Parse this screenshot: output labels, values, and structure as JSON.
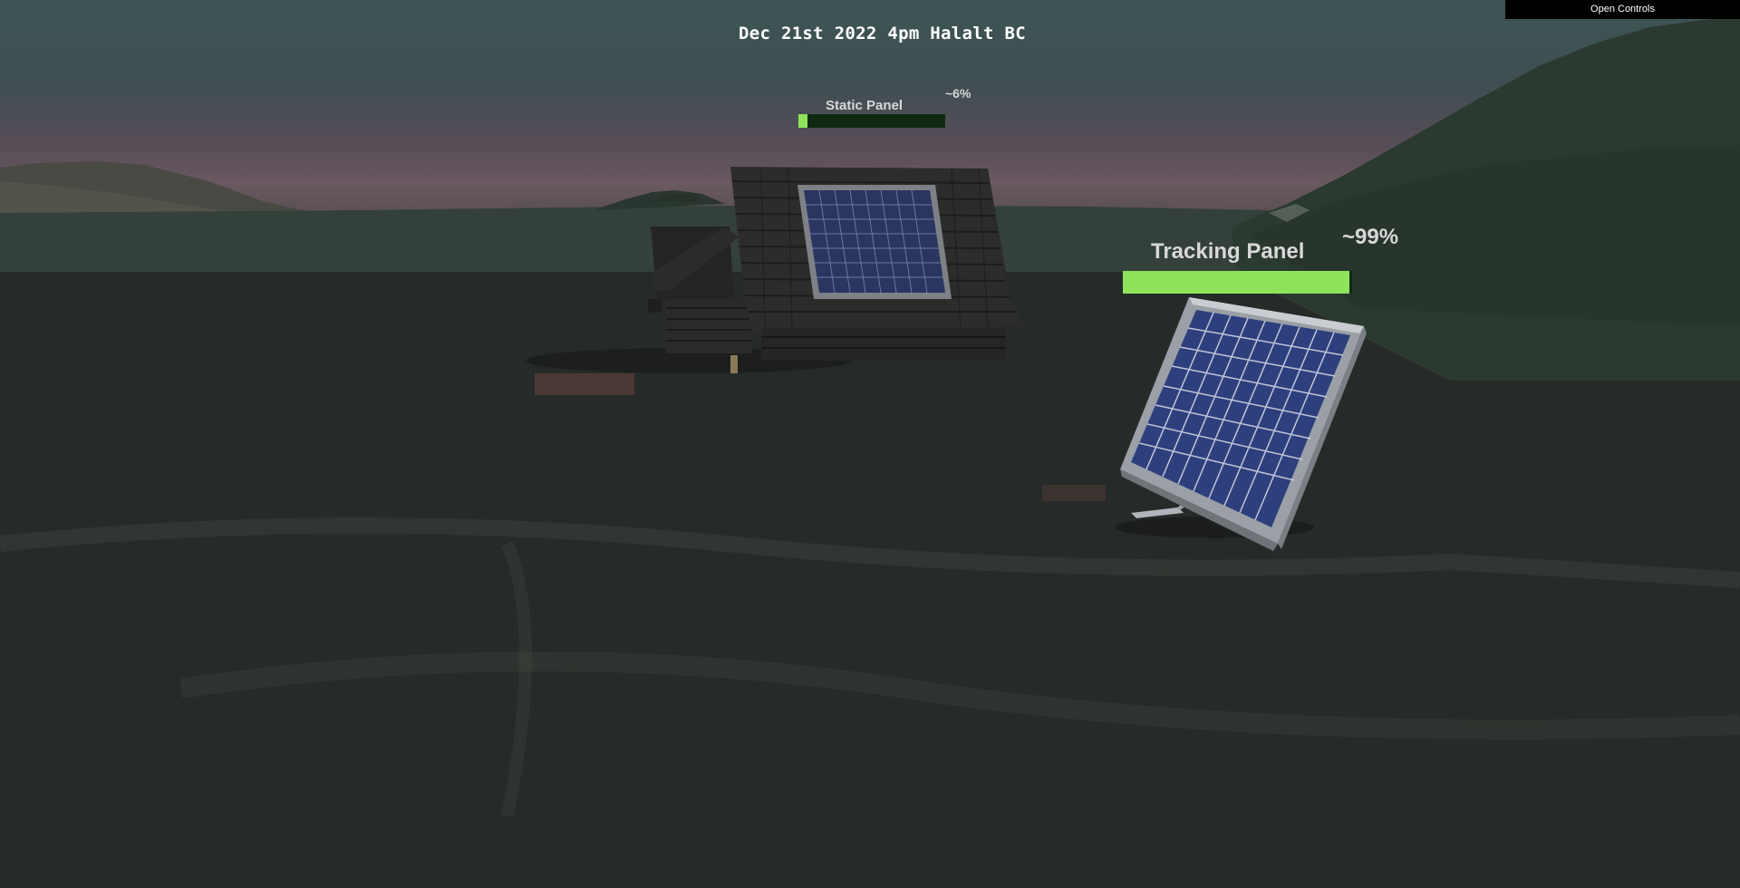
{
  "hud": {
    "title": "Dec 21st 2022 4pm Halalt BC",
    "open_controls_label": "Open Controls"
  },
  "static_panel": {
    "label": "Static Panel",
    "percent_label": "~6%",
    "efficiency": 0.06
  },
  "tracking_panel": {
    "label": "Tracking Panel",
    "percent_label": "~99%",
    "efficiency": 0.99
  },
  "colors": {
    "bar_fill": "#8ee35a",
    "bar_track": "#0f2a12",
    "panel_cells": "#2a3b78",
    "panel_frame": "#9a9ea3"
  }
}
